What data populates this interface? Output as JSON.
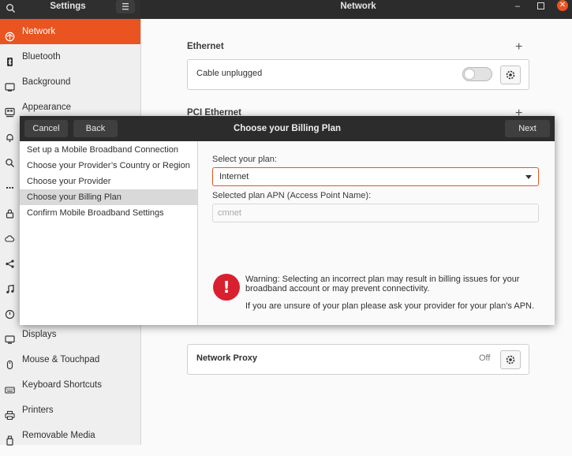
{
  "window": {
    "settings_title": "Settings",
    "panel_title": "Network",
    "minimize_glyph": "–",
    "close_glyph": "✕"
  },
  "sidebar": {
    "items": [
      {
        "label": "Network",
        "icon": "network-icon",
        "active": true
      },
      {
        "label": "Bluetooth",
        "icon": "bluetooth-icon"
      },
      {
        "label": "Background",
        "icon": "background-icon"
      },
      {
        "label": "Appearance",
        "icon": "appearance-icon"
      },
      {
        "label": "Displays",
        "icon": "displays-icon"
      },
      {
        "label": "Mouse & Touchpad",
        "icon": "mouse-icon"
      },
      {
        "label": "Keyboard Shortcuts",
        "icon": "keyboard-icon"
      },
      {
        "label": "Printers",
        "icon": "printer-icon"
      },
      {
        "label": "Removable Media",
        "icon": "removable-media-icon"
      }
    ]
  },
  "network": {
    "ethernet_title": "Ethernet",
    "ethernet_status": "Cable unplugged",
    "pci_ethernet_title": "PCI Ethernet",
    "proxy_label": "Network Proxy",
    "proxy_status": "Off",
    "ethernet_enabled": false
  },
  "dialog": {
    "title": "Choose your Billing Plan",
    "cancel_label": "Cancel",
    "back_label": "Back",
    "next_label": "Next",
    "steps": [
      "Set up a Mobile Broadband Connection",
      "Choose your Provider’s Country or Region",
      "Choose your Provider",
      "Choose your Billing Plan",
      "Confirm Mobile Broadband Settings"
    ],
    "active_step": 3,
    "select_plan_label": "Select your plan:",
    "selected_plan": "Internet",
    "apn_label": "Selected plan APN (Access Point Name):",
    "apn_value": "cmnet",
    "warning_line1": "Warning: Selecting an incorrect plan may result in billing issues for your",
    "warning_line2": "broadband account or may prevent connectivity.",
    "info_text": "If you are unsure of your plan please ask your provider for your plan’s APN."
  },
  "colors": {
    "accent": "#e95420",
    "warning": "#d9202f",
    "header": "#2c2c2c"
  }
}
